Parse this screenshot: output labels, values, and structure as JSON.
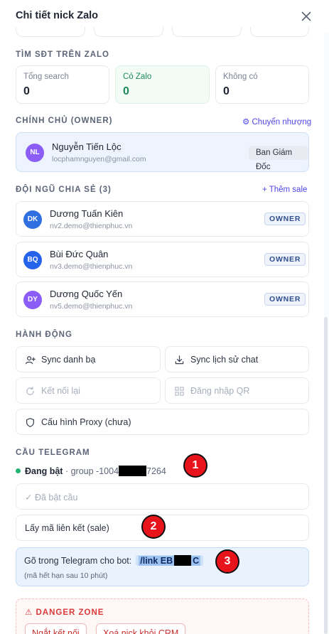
{
  "dialog": {
    "title": "Chi tiết nick Zalo"
  },
  "search_section": {
    "label": "TÌM SĐT TRÊN ZALO",
    "stats": [
      {
        "label": "Tổng search",
        "value": "0"
      },
      {
        "label": "Có Zalo",
        "value": "0"
      },
      {
        "label": "Không có",
        "value": "0"
      }
    ]
  },
  "owner_section": {
    "label": "CHÍNH CHỦ (OWNER)",
    "transfer_link": "⚙ Chuyển nhượng",
    "owner": {
      "initials": "NL",
      "name": "Nguyễn Tiến Lộc",
      "email": "locphamnguyen@gmail.com",
      "role": "Ban Giám Đốc"
    }
  },
  "team_section": {
    "label": "ĐỘI NGŨ CHIA SẺ (3)",
    "add_link": "+ Thêm sale",
    "members": [
      {
        "initials": "DK",
        "name": "Dương Tuấn Kiên",
        "email": "nv2.demo@thienphuc.vn",
        "tag": "OWNER"
      },
      {
        "initials": "BQ",
        "name": "Bùi Đức Quân",
        "email": "nv3.demo@thienphuc.vn",
        "tag": "OWNER"
      },
      {
        "initials": "DY",
        "name": "Dương Quốc Yến",
        "email": "nv5.demo@thienphuc.vn",
        "tag": "OWNER"
      }
    ]
  },
  "actions_section": {
    "label": "HÀNH ĐỘNG",
    "sync_contacts": "Sync danh bạ",
    "sync_history": "Sync lịch sử chat",
    "reconnect": "Kết nối lại",
    "qr_login": "Đăng nhập QR",
    "proxy_config": "Cấu hình Proxy (chưa)"
  },
  "telegram_section": {
    "label": "CẦU TELEGRAM",
    "status": "Đang bật",
    "group_prefix": "· group -1004",
    "group_suffix": "7264",
    "enabled_button": "✓ Đã bật cầu",
    "get_link_button": "Lấy mã liên kết (sale)",
    "instruction": "Gõ trong Telegram cho bot:",
    "command_prefix": "/link EB",
    "command_suffix": "C",
    "expiry": "(mã hết hạn sau 10 phút)"
  },
  "annotations": [
    "1",
    "2",
    "3"
  ],
  "danger_section": {
    "title": "⚠ DANGER ZONE",
    "disconnect": "Ngắt kết nối",
    "delete": "Xoá nick khỏi CRM"
  },
  "colors": {
    "accent": "#4f46e5",
    "success": "#22b573",
    "danger": "#d93a3a",
    "badge": "#e8141b",
    "avatar_nl": "#8b5cf6",
    "avatar_dk": "#2f6fe0",
    "avatar_bq": "#2563eb",
    "avatar_dy": "#8b5cf6"
  }
}
